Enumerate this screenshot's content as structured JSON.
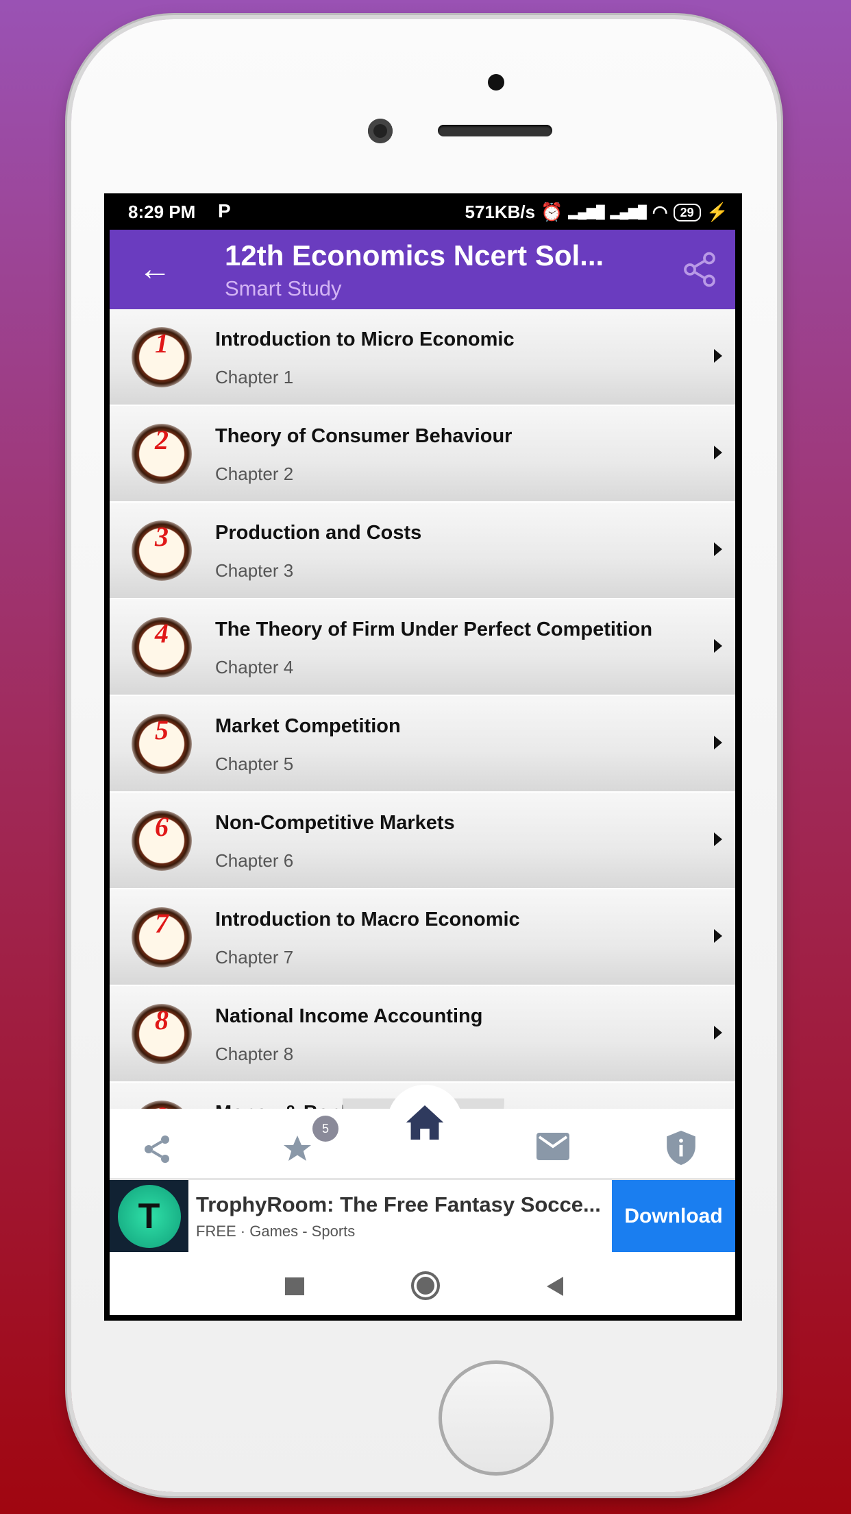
{
  "status_bar": {
    "time": "8:29 PM",
    "app_indicator": "P",
    "speed": "571KB/s",
    "network": "4G",
    "battery": "29"
  },
  "header": {
    "title": "12th Economics Ncert Sol...",
    "subtitle": "Smart Study",
    "color": "#6a3cbf"
  },
  "chapters": [
    {
      "number": "1",
      "title": "Introduction to Micro Economic",
      "subtitle": "Chapter 1"
    },
    {
      "number": "2",
      "title": "Theory of Consumer Behaviour",
      "subtitle": "Chapter 2"
    },
    {
      "number": "3",
      "title": "Production and Costs",
      "subtitle": "Chapter 3"
    },
    {
      "number": "4",
      "title": "The Theory of Firm Under Perfect Competition",
      "subtitle": "Chapter 4"
    },
    {
      "number": "5",
      "title": "Market Competition",
      "subtitle": "Chapter 5"
    },
    {
      "number": "6",
      "title": "Non-Competitive Markets",
      "subtitle": "Chapter 6"
    },
    {
      "number": "7",
      "title": "Introduction to Macro Economic",
      "subtitle": "Chapter 7"
    },
    {
      "number": "8",
      "title": "National Income Accounting",
      "subtitle": "Chapter 8"
    },
    {
      "number": "9",
      "title": "Money & Banking",
      "subtitle": ""
    }
  ],
  "bottom_nav": {
    "items": [
      "share-icon",
      "star-icon",
      "home-icon",
      "mail-icon",
      "info-shield-icon"
    ],
    "star_badge": "5"
  },
  "ad": {
    "title": "TrophyRoom: The Free Fantasy Socce...",
    "subtitle": "FREE · Games - Sports",
    "cta": "Download",
    "cta_color": "#1a7ef0"
  }
}
